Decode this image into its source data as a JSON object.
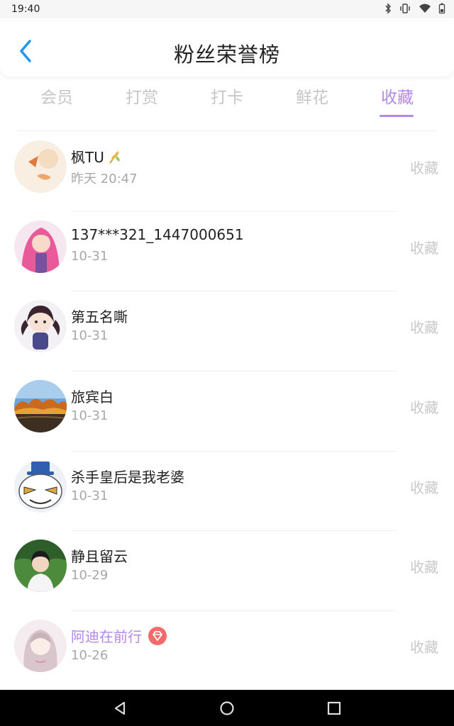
{
  "status": {
    "time": "19:40"
  },
  "header": {
    "title": "粉丝荣誉榜"
  },
  "tabs": [
    {
      "label": "会员",
      "active": false
    },
    {
      "label": "打赏",
      "active": false
    },
    {
      "label": "打卡",
      "active": false
    },
    {
      "label": "鲜花",
      "active": false
    },
    {
      "label": "收藏",
      "active": true
    }
  ],
  "list": [
    {
      "name": "枫TU",
      "date": "昨天 20:47",
      "action": "收藏",
      "badge": "wheat-icon",
      "vip": false
    },
    {
      "name": "137***321_1447000651",
      "date": "10-31",
      "action": "收藏",
      "badge": null,
      "vip": false
    },
    {
      "name": "第五名嘶",
      "date": "10-31",
      "action": "收藏",
      "badge": null,
      "vip": false
    },
    {
      "name": "旅宾白",
      "date": "10-31",
      "action": "收藏",
      "badge": null,
      "vip": false
    },
    {
      "name": "杀手皇后是我老婆",
      "date": "10-31",
      "action": "收藏",
      "badge": null,
      "vip": false
    },
    {
      "name": "静且留云",
      "date": "10-29",
      "action": "收藏",
      "badge": null,
      "vip": false
    },
    {
      "name": "阿迪在前行",
      "date": "10-26",
      "action": "收藏",
      "badge": "diamond-badge-icon",
      "vip": true
    }
  ],
  "colors": {
    "accent": "#b487e8",
    "back": "#2196f3",
    "muted": "#c8c8c8"
  }
}
